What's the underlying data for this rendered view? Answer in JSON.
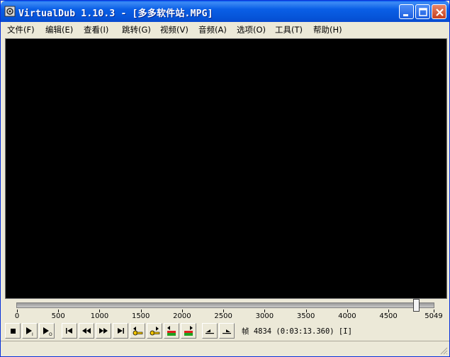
{
  "window": {
    "title": "VirtualDub 1.10.3 - [多多软件站.MPG]",
    "icon": "virtualdub-app-icon"
  },
  "menu": [
    {
      "label": "文件(F)"
    },
    {
      "label": "编辑(E)"
    },
    {
      "label": "查看(I)"
    },
    {
      "label": "跳转(G)"
    },
    {
      "label": "视频(V)"
    },
    {
      "label": "音频(A)"
    },
    {
      "label": "选项(O)"
    },
    {
      "label": "工具(T)"
    },
    {
      "label": "帮助(H)"
    }
  ],
  "timeline": {
    "ticks": [
      "0",
      "500",
      "1000",
      "1500",
      "2000",
      "2500",
      "3000",
      "3500",
      "4000",
      "4500",
      "5049"
    ],
    "current_frame": 4834,
    "total_frames": 5049
  },
  "toolbar": {
    "buttons": [
      {
        "name": "stop-button",
        "icon": "stop-icon"
      },
      {
        "name": "play-input-button",
        "icon": "play-input-icon"
      },
      {
        "name": "play-output-button",
        "icon": "play-output-icon"
      },
      {
        "name": "start-button",
        "icon": "go-start-icon"
      },
      {
        "name": "prev-frame-button",
        "icon": "step-back-icon"
      },
      {
        "name": "next-frame-button",
        "icon": "step-forward-icon"
      },
      {
        "name": "end-button",
        "icon": "go-end-icon"
      },
      {
        "name": "prev-keyframe-button",
        "icon": "key-prev-icon"
      },
      {
        "name": "next-keyframe-button",
        "icon": "key-next-icon"
      },
      {
        "name": "prev-scene-button",
        "icon": "scene-prev-icon"
      },
      {
        "name": "next-scene-button",
        "icon": "scene-next-icon"
      },
      {
        "name": "mark-in-button",
        "icon": "mark-in-icon"
      },
      {
        "name": "mark-out-button",
        "icon": "mark-out-icon"
      }
    ],
    "frame_info": "帧 4834 (0:03:13.360) [I]"
  },
  "colors": {
    "titlebar": "#0a5fe6",
    "video_bg": "#000000",
    "chrome": "#ece9d8"
  }
}
